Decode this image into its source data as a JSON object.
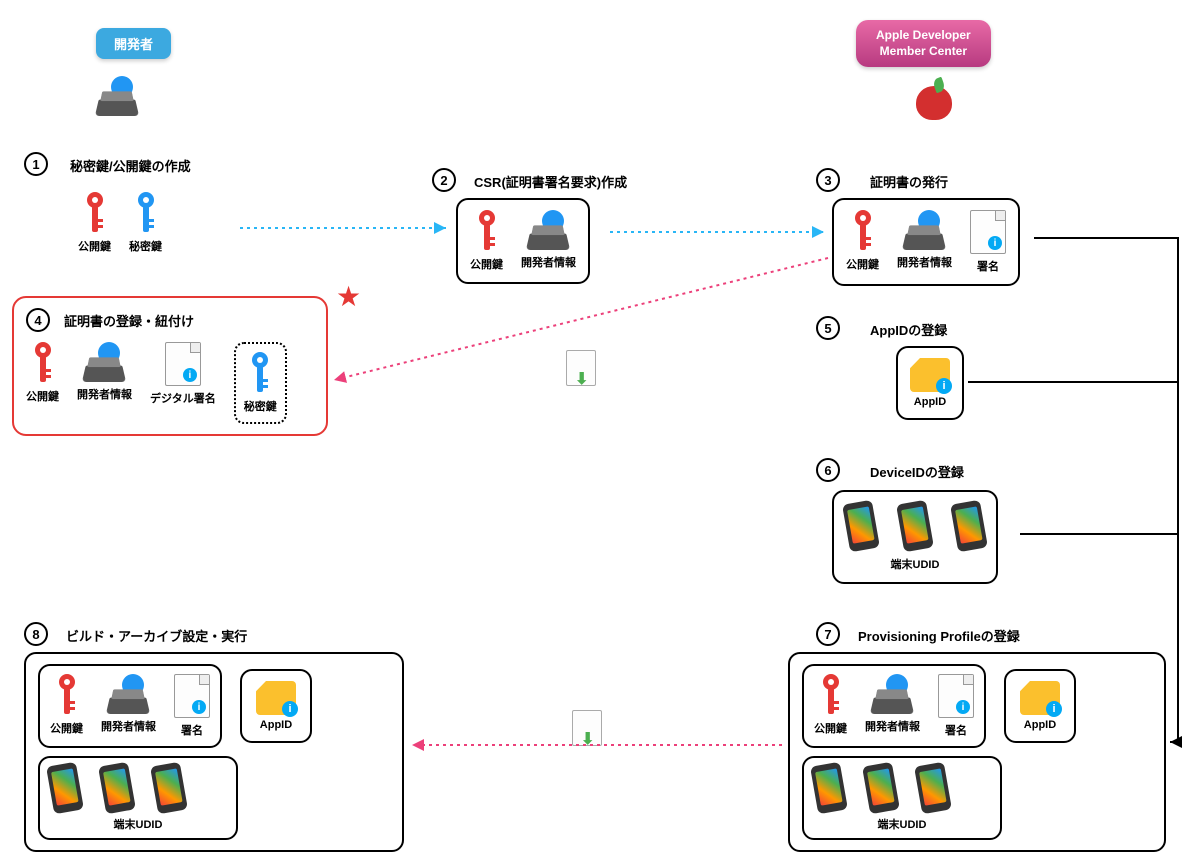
{
  "actors": {
    "developer": "開発者",
    "apple": "Apple Developer\nMember Center"
  },
  "icons": {
    "public_key": "公開鍵",
    "private_key": "秘密鍵",
    "dev_info": "開発者情報",
    "digital_sign": "デジタル署名",
    "signature": "署名",
    "appid": "AppID",
    "udid": "端末UDID"
  },
  "steps": {
    "s1": {
      "num": "1",
      "title": "秘密鍵/公開鍵の作成"
    },
    "s2": {
      "num": "2",
      "title": "CSR(証明書署名要求)作成"
    },
    "s3": {
      "num": "3",
      "title": "証明書の発行"
    },
    "s4": {
      "num": "4",
      "title": "証明書の登録・紐付け"
    },
    "s5": {
      "num": "5",
      "title": "AppIDの登録"
    },
    "s6": {
      "num": "6",
      "title": "DeviceIDの登録"
    },
    "s7": {
      "num": "7",
      "title": "Provisioning Profileの登録"
    },
    "s8": {
      "num": "8",
      "title": "ビルド・アーカイブ設定・実行"
    }
  }
}
